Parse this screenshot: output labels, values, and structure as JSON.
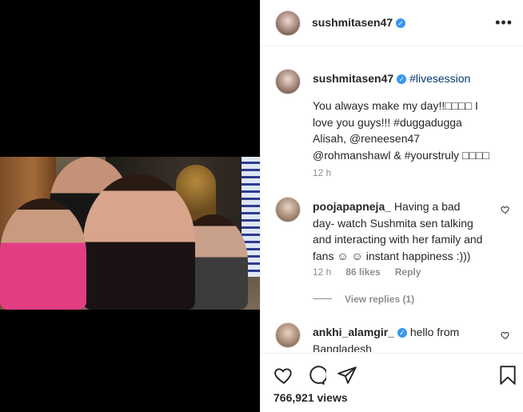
{
  "post": {
    "username": "sushmitasen47",
    "more_label": "•••"
  },
  "caption": {
    "username": "sushmitasen47",
    "hashtag": "#livesession",
    "text": "You always make my day!!□□□□ I love you guys!!! #duggadugga Alisah, @reneesen47 @rohmanshawl & #yourstruly □□□□",
    "time": "12 h"
  },
  "comments": [
    {
      "username": "poojapapneja_",
      "text": "Having a bad day- watch Sushmita sen talking and interacting with her family and fans ☺ ☺ instant happiness :)))",
      "time": "12 h",
      "likes": "86 likes",
      "reply": "Reply",
      "view_replies": "View replies (1)"
    },
    {
      "username": "ankhi_alamgir_",
      "text": "hello from Bangladesh"
    }
  ],
  "actions": {
    "icons": [
      "heart-icon",
      "comment-icon",
      "share-icon",
      "bookmark-icon"
    ],
    "views": "766,921 views"
  }
}
